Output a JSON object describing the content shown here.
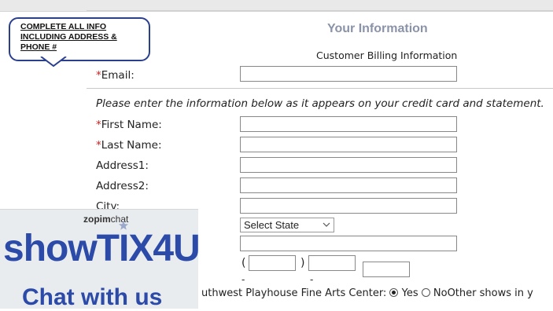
{
  "note": {
    "lines": [
      "COMPLETE ALL INFO",
      "INCLUDING ADDRESS &",
      "PHONE #"
    ]
  },
  "header": {
    "title": "Your Information",
    "subtitle": "Customer Billing Information"
  },
  "fields": {
    "email_label": "Email:",
    "notice": "Please enter the information below as it appears on your credit card and statement.",
    "first_name_label": "First Name:",
    "last_name_label": "Last Name:",
    "address1_label": "Address1:",
    "address2_label": "Address2:",
    "city_label": "City:",
    "required_marker": "*"
  },
  "state_select": {
    "selected": "Select State"
  },
  "phone": {
    "open_paren": "(",
    "close_paren": ")",
    "dash": "-"
  },
  "chat_widget": {
    "provider_a": "zopim",
    "provider_b": "chat",
    "brand": "showTIX4U",
    "cta": "Chat with us"
  },
  "mailing": {
    "text_start": "uthwest Playhouse Fine Arts Center:",
    "yes_label": "Yes",
    "no_label": "No",
    "text_end": "Other shows in y"
  }
}
